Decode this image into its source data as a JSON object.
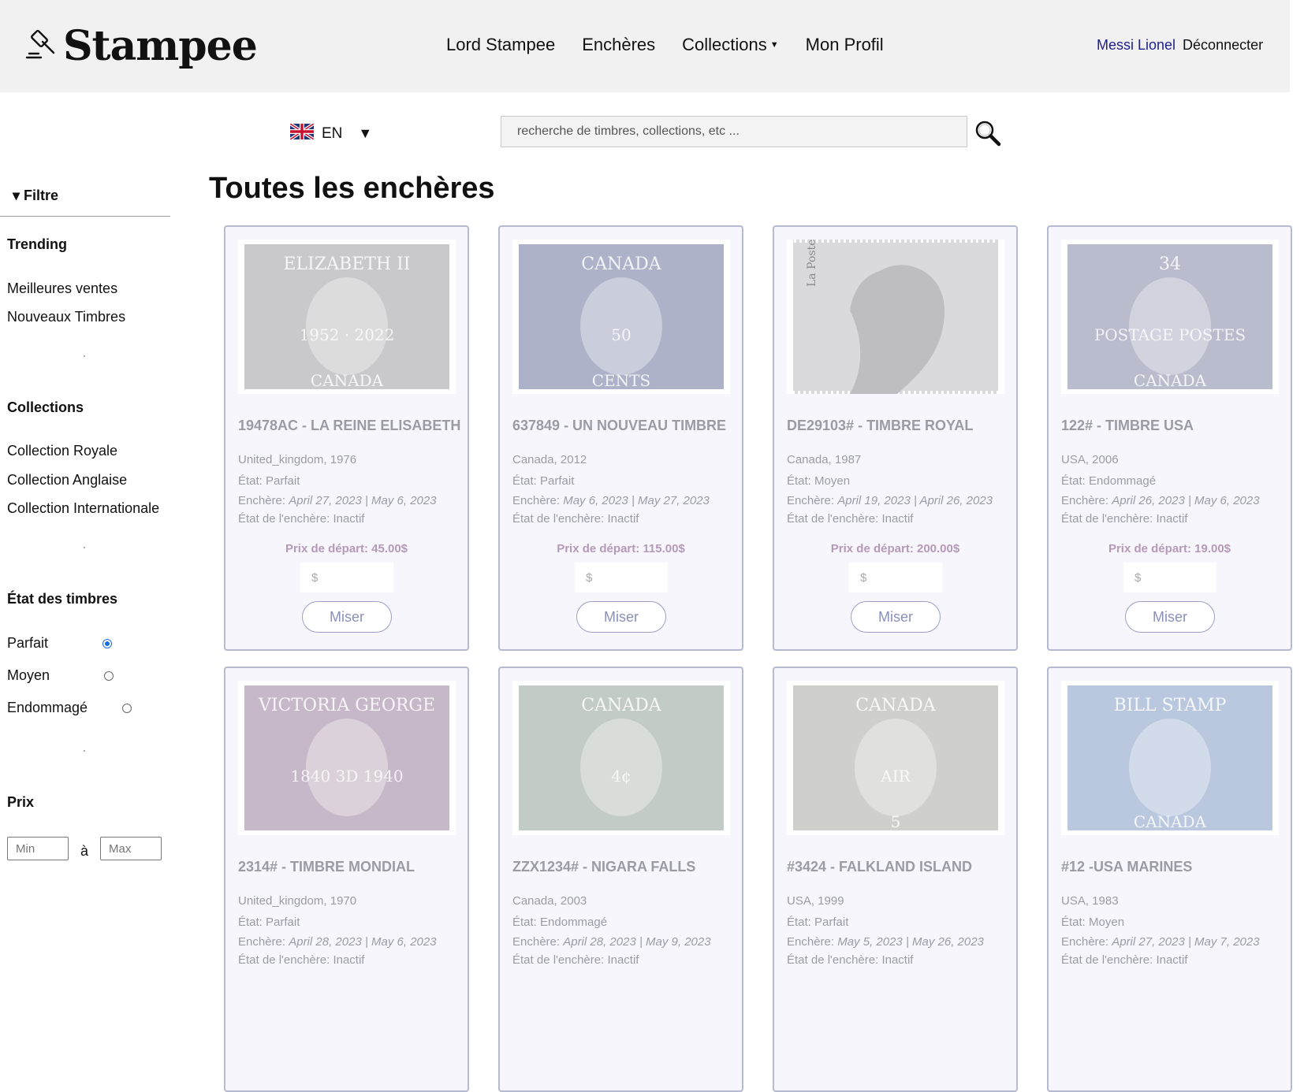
{
  "header": {
    "logo_text": "Stampee",
    "nav": [
      "Lord Stampee",
      "Enchères",
      "Collections",
      "Mon Profil"
    ],
    "user_name": "Messi Lionel",
    "logout": "Déconnecter"
  },
  "language": {
    "code": "EN",
    "arrow": "▼"
  },
  "search": {
    "placeholder": "recherche de timbres, collections, etc ..."
  },
  "sidebar": {
    "filter_title": "▾ Filtre",
    "trending_title": "Trending",
    "trending": [
      "Meilleures ventes",
      "Nouveaux Timbres"
    ],
    "collections_title": "Collections",
    "collections": [
      "Collection Royale",
      "Collection Anglaise",
      "Collection Internationale"
    ],
    "state_title": "État des timbres",
    "states": [
      "Parfait",
      "Moyen",
      "Endommagé"
    ],
    "selected_state": "Parfait",
    "price_title": "Prix",
    "price_min_placeholder": "Min",
    "price_max_placeholder": "Max",
    "price_separator": "à"
  },
  "main": {
    "title": "Toutes les enchères"
  },
  "card_labels": {
    "etat": "État:",
    "enchere": "Enchère:",
    "etat_enchere": "État de l'enchère:",
    "bid_placeholder": "$",
    "bid_button": "Miser"
  },
  "cards": [
    {
      "title": "19478AC - LA REINE ELISABETH",
      "origin": "United_kingdom, 1976",
      "etat": "Parfait",
      "dates": "April 27, 2023 | May 6, 2023",
      "status": "Inactif",
      "start_price": "Prix de départ: 45.00$",
      "stamp_text": "ELIZABETH II",
      "stamp_sub": "1952 · 2022",
      "stamp_country": "CANADA",
      "tint": "#c9c9cb"
    },
    {
      "title": "637849 - UN NOUVEAU TIMBRE",
      "origin": "Canada, 2012",
      "etat": "Parfait",
      "dates": "May 6, 2023 | May 27, 2023",
      "status": "Inactif",
      "start_price": "Prix de départ: 115.00$",
      "stamp_text": "CANADA",
      "stamp_sub": "50",
      "stamp_country": "CENTS",
      "tint": "#aeb2c8"
    },
    {
      "title": "DE29103# - TIMBRE ROYAL",
      "origin": "Canada, 1987",
      "etat": "Moyen",
      "dates": "April 19, 2023 | April 26, 2023",
      "status": "Inactif",
      "start_price": "Prix de départ: 200.00$",
      "stamp_text": "La Poste",
      "stamp_sub": "",
      "stamp_country": "",
      "tint": "#dadadd"
    },
    {
      "title": "122# - TIMBRE USA",
      "origin": "USA, 2006",
      "etat": "Endommagé",
      "dates": "April 26, 2023 | May 6, 2023",
      "status": "Inactif",
      "start_price": "Prix de départ: 19.00$",
      "stamp_text": "34",
      "stamp_sub": "POSTAGE POSTES",
      "stamp_country": "CANADA",
      "tint": "#b9bccd"
    },
    {
      "title": "2314# - TIMBRE MONDIAL",
      "origin": "United_kingdom, 1970",
      "etat": "Parfait",
      "dates": "April 28, 2023 | May 6, 2023",
      "status": "Inactif",
      "start_price": "",
      "stamp_text": "VICTORIA   GEORGE",
      "stamp_sub": "1840  3D  1940",
      "stamp_country": "",
      "tint": "#c6b8c8"
    },
    {
      "title": "ZZX1234# - NIGARA FALLS",
      "origin": "Canada, 2003",
      "etat": "Endommagé",
      "dates": "April 28, 2023 | May 9, 2023",
      "status": "Inactif",
      "start_price": "",
      "stamp_text": "CANADA",
      "stamp_sub": "4¢",
      "stamp_country": "",
      "tint": "#c3cbc6"
    },
    {
      "title": "#3424 - FALKLAND ISLAND",
      "origin": "USA, 1999",
      "etat": "Parfait",
      "dates": "May 5, 2023 | May 26, 2023",
      "status": "Inactif",
      "start_price": "",
      "stamp_text": "CANADA",
      "stamp_sub": "AIR",
      "stamp_country": "5",
      "tint": "#cfcfcc"
    },
    {
      "title": "#12 -USA MARINES",
      "origin": "USA, 1983",
      "etat": "Moyen",
      "dates": "April 27, 2023 | May 7, 2023",
      "status": "Inactif",
      "start_price": "",
      "stamp_text": "BILL STAMP",
      "stamp_sub": "",
      "stamp_country": "CANADA",
      "tint": "#b9c8de"
    }
  ]
}
